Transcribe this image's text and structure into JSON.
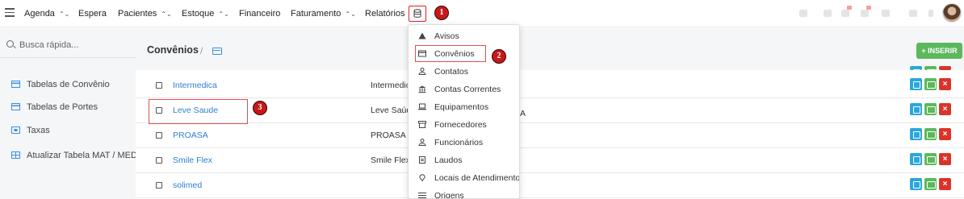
{
  "topnav": {
    "items": [
      {
        "label": "Agenda",
        "chevron": "⌃⌄"
      },
      {
        "label": "Espera",
        "chevron": ""
      },
      {
        "label": "Pacientes",
        "chevron": "⌃⌄"
      },
      {
        "label": "Estoque",
        "chevron": "⌃⌄"
      },
      {
        "label": "Financeiro",
        "chevron": ""
      },
      {
        "label": "Faturamento",
        "chevron": "⌃⌄"
      },
      {
        "label": "Relatórios",
        "chevron": ""
      }
    ],
    "db_icon": "database-icon"
  },
  "markers": [
    "1",
    "2",
    "3"
  ],
  "sidebar": {
    "search_placeholder": "Busca rápida...",
    "items": [
      {
        "label": "Tabelas de Convênio",
        "icon": "card-icon"
      },
      {
        "label": "Tabelas de Portes",
        "icon": "card-icon"
      },
      {
        "label": "Taxas",
        "icon": "ticket-icon"
      },
      {
        "label": "Atualizar Tabela MAT / MED",
        "icon": "table-icon"
      }
    ]
  },
  "main": {
    "title": "Convênios",
    "breadcrumb_sep": "/",
    "insert_label": "+ INSERIR",
    "rows": [
      {
        "name": "Intermedica",
        "name2": "Intermedic"
      },
      {
        "name": "Leve Saude",
        "name2": "Leve Saúde"
      },
      {
        "name": "PROASA",
        "name2": "PROASA"
      },
      {
        "name": "Smile Flex",
        "name2": "Smile Flex"
      },
      {
        "name": "solimed",
        "name2": ""
      }
    ],
    "overlap_text": "A",
    "delete_glyph": "×"
  },
  "dropdown": {
    "items": [
      {
        "label": "Avisos",
        "icon": "warning-icon"
      },
      {
        "label": "Convênios",
        "icon": "card-icon"
      },
      {
        "label": "Contatos",
        "icon": "person-icon"
      },
      {
        "label": "Contas Correntes",
        "icon": "bank-icon"
      },
      {
        "label": "Equipamentos",
        "icon": "laptop-icon"
      },
      {
        "label": "Fornecedores",
        "icon": "box-icon"
      },
      {
        "label": "Funcionários",
        "icon": "person-icon"
      },
      {
        "label": "Laudos",
        "icon": "document-icon"
      },
      {
        "label": "Locais de Atendimento",
        "icon": "location-icon"
      },
      {
        "label": "Origens",
        "icon": "list-icon"
      }
    ]
  },
  "colors": {
    "link": "#2f7fd0",
    "accent_blue": "#29a7dc",
    "success": "#5cb85c",
    "danger": "#d9342b",
    "marker": "#c51a1a"
  }
}
